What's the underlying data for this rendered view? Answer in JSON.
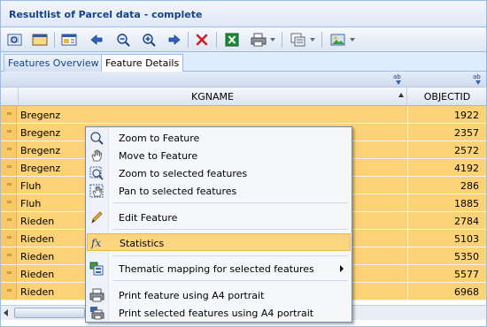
{
  "window": {
    "title": "Resultlist of Parcel data - complete"
  },
  "toolbar": {
    "buttons": [
      {
        "icon": "zoom-extent-icon"
      },
      {
        "icon": "window-icon"
      },
      {
        "icon": "table-select-icon"
      },
      {
        "icon": "arrow-left-icon"
      },
      {
        "icon": "zoom-out-icon"
      },
      {
        "icon": "zoom-in-icon"
      },
      {
        "icon": "arrow-right-icon"
      },
      {
        "icon": "delete-icon"
      },
      {
        "icon": "excel-icon"
      },
      {
        "icon": "print-icon"
      },
      {
        "icon": "copy-icon"
      },
      {
        "icon": "image-icon"
      }
    ]
  },
  "tabs": [
    {
      "label": "Features Overview",
      "active": false
    },
    {
      "label": "Feature Details",
      "active": true
    }
  ],
  "subbar": {
    "icon_text": "ab"
  },
  "grid": {
    "columns": [
      "KGNAME",
      "OBJECTID"
    ],
    "sort": "ascending",
    "rows": [
      {
        "kgname": "Bregenz",
        "objectid": "1922"
      },
      {
        "kgname": "Bregenz",
        "objectid": "2357"
      },
      {
        "kgname": "Bregenz",
        "objectid": "2572"
      },
      {
        "kgname": "Bregenz",
        "objectid": "4192"
      },
      {
        "kgname": "Fluh",
        "objectid": "286"
      },
      {
        "kgname": "Fluh",
        "objectid": "1885"
      },
      {
        "kgname": "Rieden",
        "objectid": "2784"
      },
      {
        "kgname": "Rieden",
        "objectid": "5103"
      },
      {
        "kgname": "Rieden",
        "objectid": "5350"
      },
      {
        "kgname": "Rieden",
        "objectid": "5577"
      },
      {
        "kgname": "Rieden",
        "objectid": "6968"
      }
    ],
    "row_color": "#fbd276"
  },
  "context_menu": {
    "items": [
      {
        "label": "Zoom to Feature",
        "icon": "magnifier-icon"
      },
      {
        "label": "Move to Feature",
        "icon": "pan-hand-icon"
      },
      {
        "label": "Zoom to selected features",
        "icon": "zoom-selection-icon"
      },
      {
        "label": "Pan to selected features",
        "icon": "pan-selection-icon"
      },
      {
        "label": "Edit Feature",
        "icon": "pencil-icon"
      },
      {
        "label": "Statistics",
        "icon": "fx-icon",
        "highlighted": true
      },
      {
        "label": "Thematic mapping for selected features",
        "icon": "thematic-map-icon",
        "submenu": true
      },
      {
        "label": "Print feature using A4 portrait",
        "icon": "printer-icon"
      },
      {
        "label": "Print selected features using A4 portrait",
        "icon": "printer-multi-icon"
      }
    ],
    "highlight_color": "#fbd580"
  }
}
